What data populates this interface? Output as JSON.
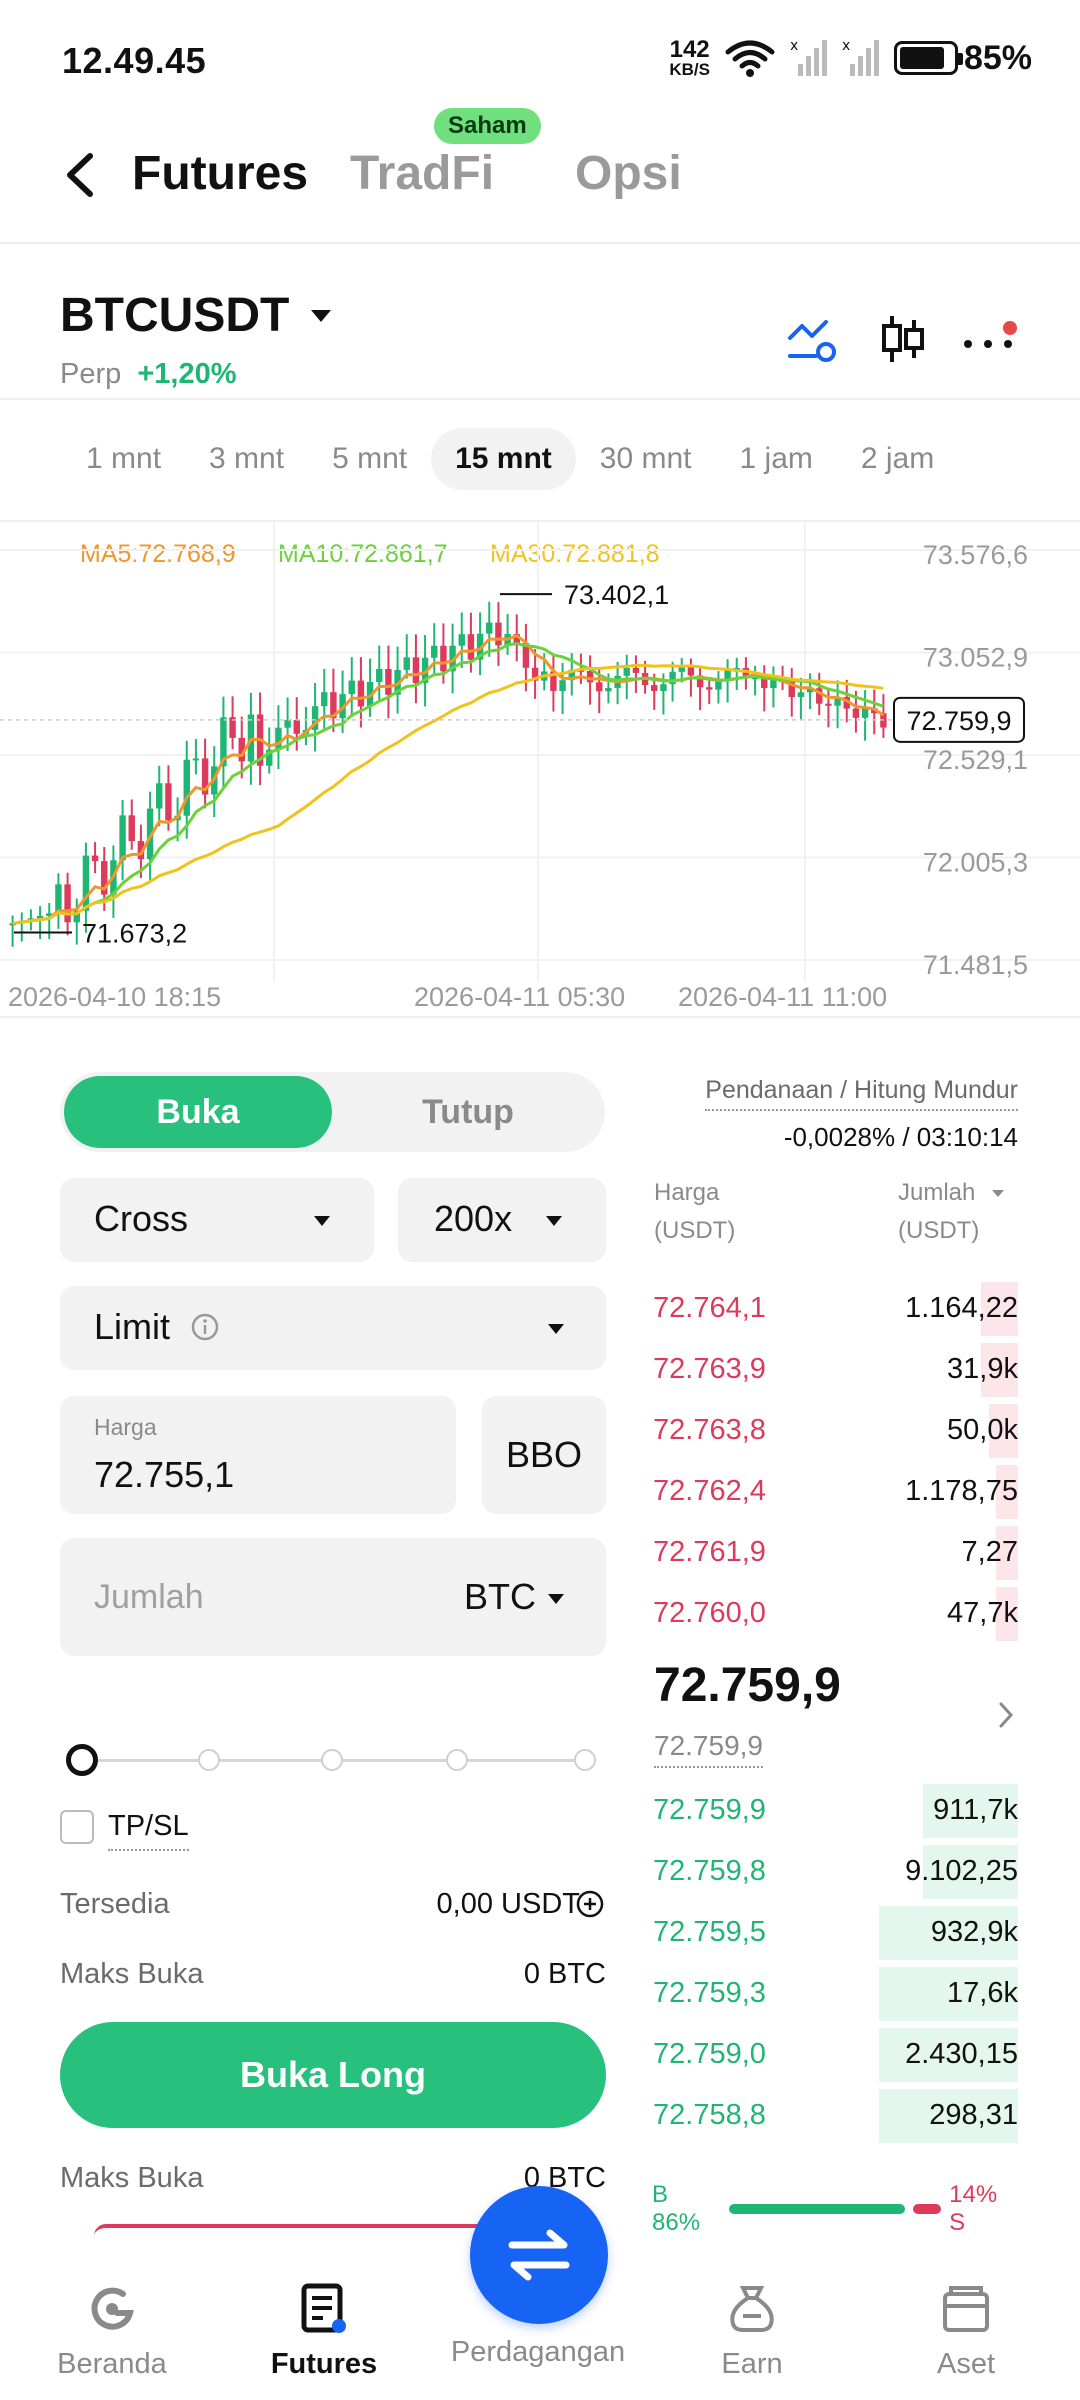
{
  "status_bar": {
    "time": "12.49.45",
    "net_speed_value": "142",
    "net_speed_unit": "KB/S",
    "battery": "85%",
    "battery_level": 0.85
  },
  "header": {
    "tabs": [
      {
        "label": "Futures",
        "active": true
      },
      {
        "label": "TradFi",
        "active": false,
        "badge": "Saham"
      },
      {
        "label": "Opsi",
        "active": false
      }
    ]
  },
  "symbol": {
    "name": "BTCUSDT",
    "type": "Perp",
    "change": "+1,20%"
  },
  "timeframes": [
    {
      "label": "1 mnt",
      "active": false
    },
    {
      "label": "3 mnt",
      "active": false
    },
    {
      "label": "5 mnt",
      "active": false
    },
    {
      "label": "15 mnt",
      "active": true
    },
    {
      "label": "30 mnt",
      "active": false
    },
    {
      "label": "1 jam",
      "active": false
    },
    {
      "label": "2 jam",
      "active": false
    }
  ],
  "chart_data": {
    "type": "candlestick",
    "ma_legend": {
      "ma5": "MA5:72.768,9",
      "ma10": "MA10:72.861,7",
      "ma30": "MA30:72.881,8"
    },
    "y_ticks": [
      "73.576,6",
      "73.052,9",
      "72.529,1",
      "72.005,3",
      "71.481,5"
    ],
    "ylim": [
      71481.5,
      73576.6
    ],
    "x_ticks": [
      "2026-04-10 18:15",
      "2026-04-11 05:30",
      "2026-04-11 11:00"
    ],
    "last_price_label": "72.759,9",
    "last_price": 72759.9,
    "high_label": "73.402,1",
    "high": 73402.1,
    "low_label": "71.673,2",
    "low": 71673.2,
    "colors": {
      "up": "#1fb673",
      "down": "#dd3a5c",
      "ma5": "#f0962a",
      "ma10": "#6cd13c",
      "ma30": "#f2c21c"
    }
  },
  "order_form": {
    "open_label": "Buka",
    "close_label": "Tutup",
    "margin_mode": "Cross",
    "leverage": "200x",
    "order_type": "Limit",
    "price_label": "Harga",
    "price_value": "72.755,1",
    "bbo_label": "BBO",
    "amount_placeholder": "Jumlah",
    "amount_unit": "BTC",
    "tpsl_label": "TP/SL",
    "available_label": "Tersedia",
    "available_value": "0,00 USDT",
    "max_open_label": "Maks Buka",
    "max_open_value": "0 BTC",
    "buy_button": "Buka Long",
    "max_open_label_2": "Maks Buka",
    "max_open_value_2": "0 BTC"
  },
  "order_book": {
    "funding_label": "Pendanaan / Hitung Mundur",
    "funding_value": "-0,0028% / 03:10:14",
    "price_header": "Harga",
    "price_unit": "(USDT)",
    "amount_header": "Jumlah",
    "amount_unit": "(USDT)",
    "asks": [
      {
        "price": "72.764,1",
        "amount": "1.164,22",
        "depth": 0.1
      },
      {
        "price": "72.763,9",
        "amount": "31,9k",
        "depth": 0.1
      },
      {
        "price": "72.763,8",
        "amount": "50,0k",
        "depth": 0.08
      },
      {
        "price": "72.762,4",
        "amount": "1.178,75",
        "depth": 0.06
      },
      {
        "price": "72.761,9",
        "amount": "7,27",
        "depth": 0.06
      },
      {
        "price": "72.760,0",
        "amount": "47,7k",
        "depth": 0.06
      }
    ],
    "mid_price": "72.759,9",
    "mid_sub": "72.759,9",
    "bids": [
      {
        "price": "72.759,9",
        "amount": "911,7k",
        "depth": 0.26
      },
      {
        "price": "72.759,8",
        "amount": "9.102,25",
        "depth": 0.26
      },
      {
        "price": "72.759,5",
        "amount": "932,9k",
        "depth": 0.38
      },
      {
        "price": "72.759,3",
        "amount": "17,6k",
        "depth": 0.38
      },
      {
        "price": "72.759,0",
        "amount": "2.430,15",
        "depth": 0.38
      },
      {
        "price": "72.758,8",
        "amount": "298,31",
        "depth": 0.38
      }
    ],
    "buy_ratio": "B 86%",
    "sell_ratio": "14% S",
    "buy_pct": 0.86
  },
  "bottom_nav": [
    {
      "label": "Beranda",
      "icon": "home-icon",
      "active": false
    },
    {
      "label": "Futures",
      "icon": "futures-icon",
      "active": true
    },
    {
      "label": "Perdagangan",
      "icon": "swap-icon",
      "active": false
    },
    {
      "label": "Earn",
      "icon": "earn-icon",
      "active": false
    },
    {
      "label": "Aset",
      "icon": "wallet-icon",
      "active": false
    }
  ]
}
